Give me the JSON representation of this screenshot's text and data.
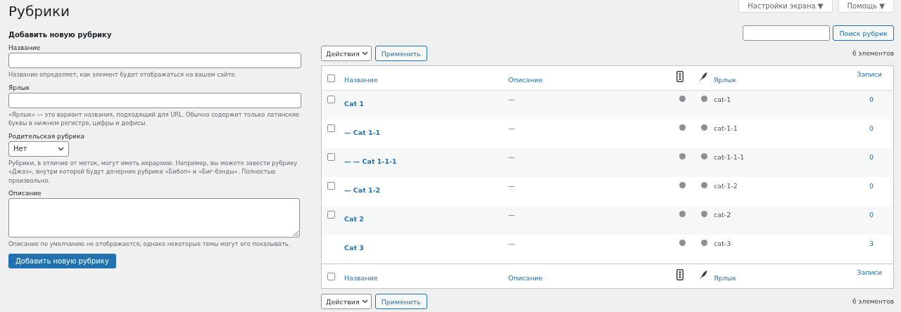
{
  "page_title": "Рубрики",
  "screen_tabs": [
    {
      "label": "Настройки экрана ▼"
    },
    {
      "label": "Помощь ▼"
    }
  ],
  "search": {
    "button": "Поиск рубрик"
  },
  "add_form": {
    "heading": "Добавить новую рубрику",
    "fields": [
      {
        "kind": "text",
        "label": "Название",
        "hint": "Название определяет, как элемент будет отображаться на вашем сайте."
      },
      {
        "kind": "text",
        "label": "Ярлык",
        "hint": "«Ярлык» — это вариант названия, подходящий для URL. Обычно содержит только латинские буквы в нижнем регистре, цифры и дефисы."
      },
      {
        "kind": "select",
        "label": "Родительская рубрика",
        "value": "Нет",
        "hint": "Рубрики, в отличие от меток, могут иметь иерархию. Например, вы можете завести рубрику «Джаз», внутри которой будут дочерние рубрики «Бибоп» и «Биг-бэнды». Полностью произвольно."
      },
      {
        "kind": "textarea",
        "label": "Описание",
        "hint": "Описание по умолчанию не отображается, однако некоторые темы могут его показывать."
      }
    ],
    "submit": "Добавить новую рубрику"
  },
  "table": {
    "top_nav": {
      "actions": "Действия",
      "apply": "Применить",
      "count": "6 элементов"
    },
    "header_columns": [
      {
        "kind": "name",
        "label": "Название"
      },
      {
        "kind": "description",
        "label": "Описание"
      },
      {
        "kind": "traffic"
      },
      {
        "kind": "feather"
      },
      {
        "kind": "slug",
        "label": "Ярлык"
      },
      {
        "kind": "posts",
        "label": "Записи"
      }
    ],
    "header_checked": false,
    "rows": [
      {
        "name": "Cat 1",
        "description": "—",
        "slug": "cat-1",
        "posts": "0",
        "checked": false
      },
      {
        "name": "— Cat 1-1",
        "description": "—",
        "slug": "cat-1-1",
        "posts": "0",
        "checked": false
      },
      {
        "name": "— — Cat 1-1-1",
        "description": "—",
        "slug": "cat-1-1-1",
        "posts": "0",
        "checked": false
      },
      {
        "name": "— Cat 1-2",
        "description": "—",
        "slug": "cat-1-2",
        "posts": "0",
        "checked": false
      },
      {
        "name": "Cat 2",
        "description": "—",
        "slug": "cat-2",
        "posts": "0",
        "checked": false
      },
      {
        "name": "Cat 3",
        "description": "—",
        "slug": "cat-3",
        "posts": "3"
      }
    ],
    "footer_columns": [
      {
        "kind": "name",
        "label": "Название"
      },
      {
        "kind": "description",
        "label": "Описание"
      },
      {
        "kind": "traffic"
      },
      {
        "kind": "feather"
      },
      {
        "kind": "slug",
        "label": "Ярлык"
      },
      {
        "kind": "posts",
        "label": "Записи"
      }
    ],
    "footer_checked": false,
    "bottom_nav": {
      "actions": "Действия",
      "apply": "Применить",
      "count": "6 элементов"
    }
  }
}
